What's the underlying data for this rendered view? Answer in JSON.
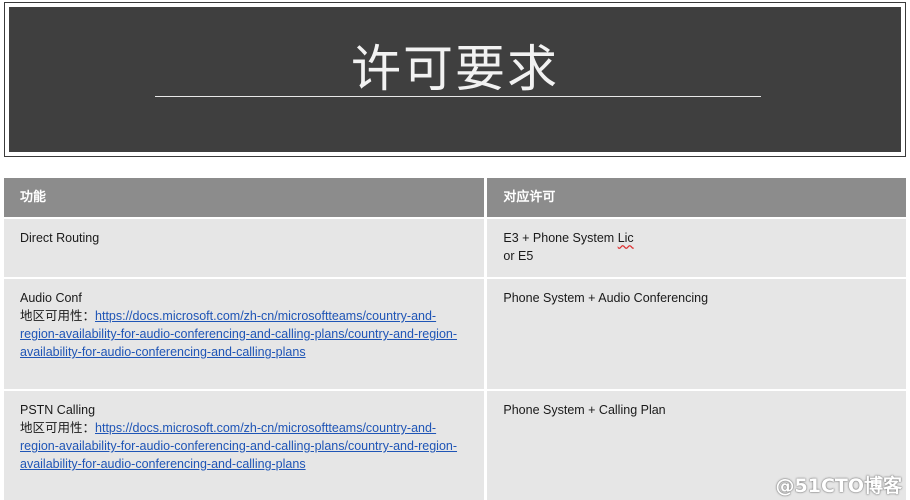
{
  "title": "许可要求",
  "table": {
    "headers": [
      "功能",
      "对应许可"
    ],
    "rows": [
      {
        "feature_name": "Direct Routing",
        "license_line1": "E3 + Phone System ",
        "license_squiggle": "Lic",
        "license_line2": "or E5"
      },
      {
        "feature_name": "Audio Conf",
        "availability_label": "地区可用性：",
        "link_text": "https://docs.microsoft.com/zh-cn/microsoftteams/country-and-region-availability-for-audio-conferencing-and-calling-plans/country-and-region-availability-for-audio-conferencing-and-calling-plans",
        "license": "Phone System + Audio Conferencing"
      },
      {
        "feature_name": "PSTN Calling",
        "availability_label": "地区可用性：",
        "link_text": "https://docs.microsoft.com/zh-cn/microsoftteams/country-and-region-availability-for-audio-conferencing-and-calling-plans/country-and-region-availability-for-audio-conferencing-and-calling-plans",
        "license": "Phone System + Calling Plan"
      }
    ]
  },
  "watermark": "@51CTO博客",
  "colors": {
    "banner_bg": "#3f3f3f",
    "header_bg": "#8c8c8c",
    "cell_bg": "#e6e6e6",
    "link": "#1f55b6"
  }
}
